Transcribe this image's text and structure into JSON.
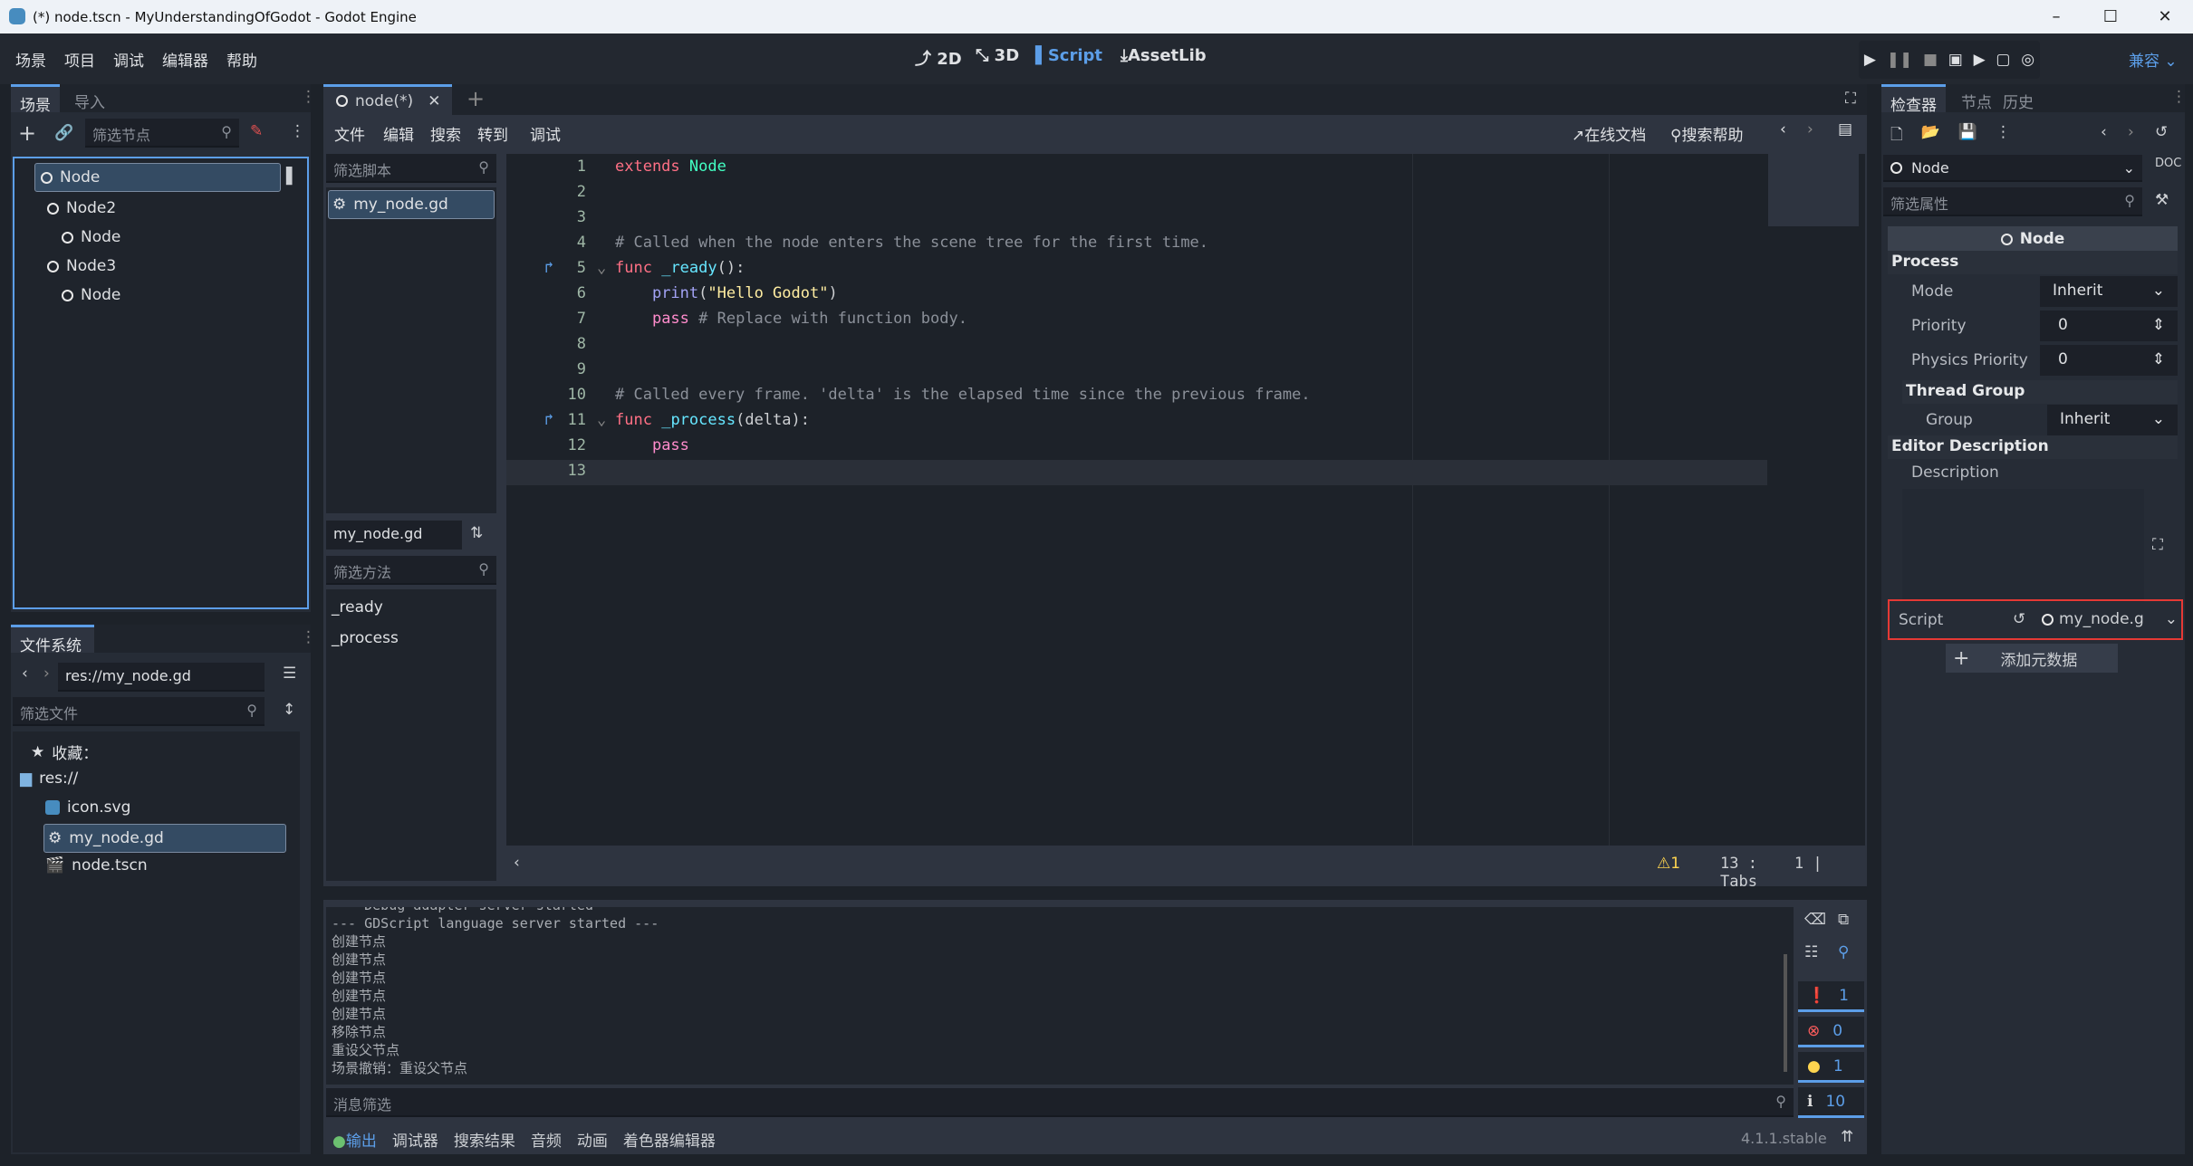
{
  "window": {
    "title": "(*) node.tscn - MyUnderstandingOfGodot - Godot Engine",
    "minimize": "–",
    "maximize": "☐",
    "close": "✕"
  },
  "menu": [
    "场景",
    "项目",
    "调试",
    "编辑器",
    "帮助"
  ],
  "workspaces": {
    "w2d": "2D",
    "w3d": "3D",
    "script": "Script",
    "assetlib": "AssetLib"
  },
  "renderer": "兼容",
  "scene_dock": {
    "tabs": [
      "场景",
      "导入"
    ],
    "filter_placeholder": "筛选节点",
    "tree": [
      {
        "label": "Node",
        "level": 0
      },
      {
        "label": "Node2",
        "level": 1
      },
      {
        "label": "Node",
        "level": 2
      },
      {
        "label": "Node3",
        "level": 1
      },
      {
        "label": "Node",
        "level": 2
      }
    ]
  },
  "filesystem": {
    "tab": "文件系统",
    "path": "res://my_node.gd",
    "filter_placeholder": "筛选文件",
    "favorites": "收藏：",
    "root": "res://",
    "files": [
      "icon.svg",
      "my_node.gd",
      "node.tscn"
    ]
  },
  "editor": {
    "tab": "node(*)",
    "menu": [
      "文件",
      "编辑",
      "搜索",
      "转到",
      "调试"
    ],
    "online_docs": "在线文档",
    "search_help": "搜索帮助",
    "script_filter": "筛选脚本",
    "scripts": [
      "my_node.gd"
    ],
    "current_script": "my_node.gd",
    "method_filter": "筛选方法",
    "methods": [
      "_ready",
      "_process"
    ],
    "status": {
      "warnings": "1",
      "line": "13",
      "col": "1",
      "indent": "Tabs"
    }
  },
  "code": [
    [
      [
        "kw",
        "extends"
      ],
      [
        "pl",
        " "
      ],
      [
        "ty",
        "Node"
      ]
    ],
    [],
    [],
    [
      [
        "cm",
        "# Called when the node enters the scene tree for the first time."
      ]
    ],
    [
      [
        "kw",
        "func"
      ],
      [
        "pl",
        " "
      ],
      [
        "fn",
        "_ready"
      ],
      [
        "pl",
        "():"
      ]
    ],
    [
      [
        "pl",
        "    "
      ],
      [
        "bi",
        "print"
      ],
      [
        "pl",
        "("
      ],
      [
        "st",
        "\"Hello Godot\""
      ],
      [
        "pl",
        ")"
      ]
    ],
    [
      [
        "pl",
        "    "
      ],
      [
        "pink",
        "pass"
      ],
      [
        "cm",
        " # Replace with function body."
      ]
    ],
    [],
    [],
    [
      [
        "cm",
        "# Called every frame. 'delta' is the elapsed time since the previous frame."
      ]
    ],
    [
      [
        "kw",
        "func"
      ],
      [
        "pl",
        " "
      ],
      [
        "fn",
        "_process"
      ],
      [
        "pl",
        "(delta):"
      ]
    ],
    [
      [
        "pl",
        "    "
      ],
      [
        "pink",
        "pass"
      ]
    ],
    []
  ],
  "output": {
    "lines": [
      "--- Debug adapter server started ---",
      "--- GDScript language server started ---",
      "创建节点",
      "创建节点",
      "创建节点",
      "创建节点",
      "创建节点",
      "移除节点",
      "重设父节点",
      "场景撤销：重设父节点"
    ],
    "filter_placeholder": "消息筛选",
    "counts": {
      "messages": "1",
      "errors": "0",
      "warnings": "1",
      "info": "10"
    }
  },
  "bottom_tabs": [
    "输出",
    "调试器",
    "搜索结果",
    "音频",
    "动画",
    "着色器编辑器"
  ],
  "version": "4.1.1.stable",
  "inspector": {
    "tabs": [
      "检查器",
      "节点",
      "历史"
    ],
    "object": "Node",
    "filter_placeholder": "筛选属性",
    "class": "Node",
    "process": "Process",
    "mode_label": "Mode",
    "mode": "Inherit",
    "priority_label": "Priority",
    "priority": "0",
    "physics_label": "Physics Priority",
    "physics": "0",
    "thread_group": "Thread Group",
    "group_label": "Group",
    "group": "Inherit",
    "editor_desc": "Editor Description",
    "desc_label": "Description",
    "script_label": "Script",
    "script": "my_node.g",
    "add_metadata": "添加元数据"
  },
  "colors": {
    "accent": "#5c9ee8",
    "highlight": "#e53935"
  }
}
